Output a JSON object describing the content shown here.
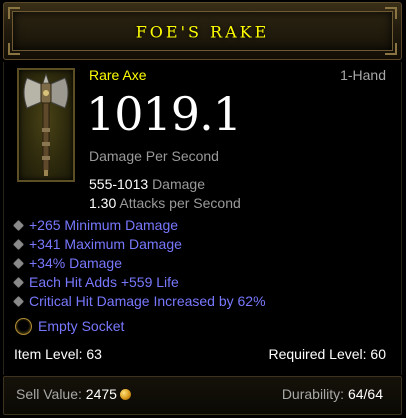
{
  "item": {
    "name": "FOE'S RAKE",
    "rarity": "Rare Axe",
    "hand": "1-Hand",
    "dps": "1019.1",
    "dps_label": "Damage Per Second",
    "damage_range": "555-1013",
    "damage_label": "Damage",
    "attack_speed": "1.30",
    "attack_speed_label": "Attacks per Second",
    "icon": "axe-icon"
  },
  "affixes": [
    "+265 Minimum Damage",
    "+341 Maximum Damage",
    "+34% Damage",
    "Each Hit Adds +559 Life",
    "Critical Hit Damage Increased by 62%"
  ],
  "socket": {
    "label": "Empty Socket"
  },
  "requirements": {
    "item_level_label": "Item Level:",
    "item_level": "63",
    "required_level_label": "Required Level:",
    "required_level": "60"
  },
  "footer": {
    "sell_label": "Sell Value:",
    "sell_value": "2475",
    "durability_label": "Durability:",
    "durability_value": "64/64"
  },
  "colors": {
    "title": "#ffff00",
    "rarity": "#ffff00",
    "affix": "#7878ff",
    "label": "#9a9a9a",
    "value": "#ffffff"
  }
}
